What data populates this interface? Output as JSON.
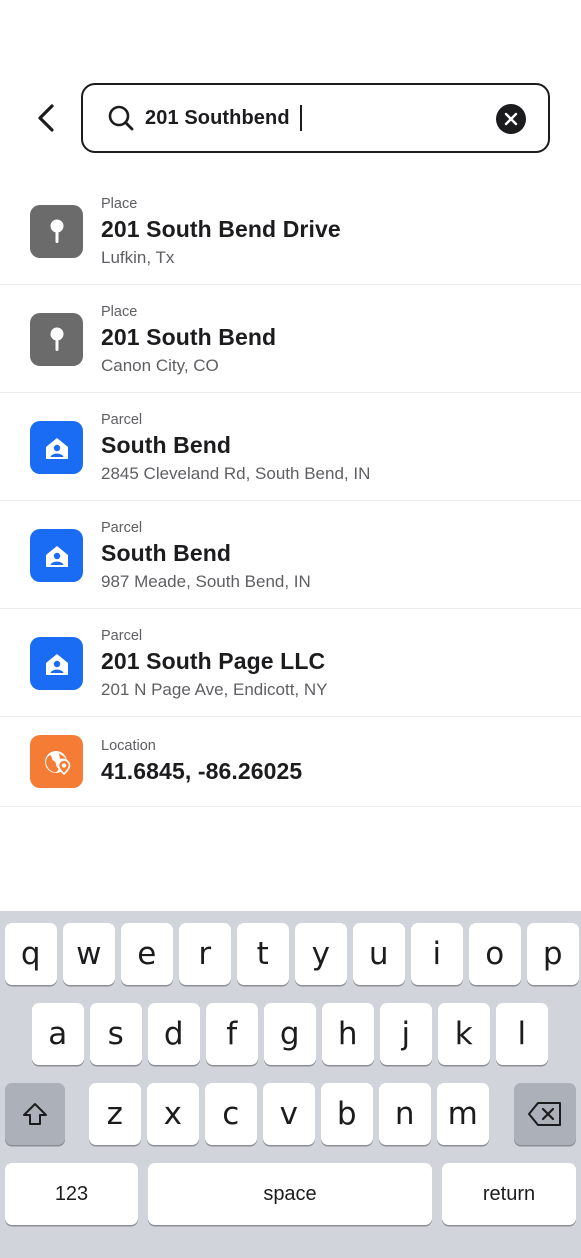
{
  "search": {
    "query": "201 Southbend"
  },
  "results": [
    {
      "type": "Place",
      "title": "201 South Bend Drive",
      "subtitle": "Lufkin, Tx",
      "icon": "pin-icon",
      "color": "#6b6b6b"
    },
    {
      "type": "Place",
      "title": "201 South Bend",
      "subtitle": "Canon City, CO",
      "icon": "pin-icon",
      "color": "#6b6b6b"
    },
    {
      "type": "Parcel",
      "title": "South Bend",
      "subtitle": "2845 Cleveland Rd, South Bend, IN",
      "icon": "parcel-owner-icon",
      "color": "#1a6cf5"
    },
    {
      "type": "Parcel",
      "title": "South Bend",
      "subtitle": "987 Meade, South Bend, IN",
      "icon": "parcel-owner-icon",
      "color": "#1a6cf5"
    },
    {
      "type": "Parcel",
      "title": "201 South Page LLC",
      "subtitle": "201 N Page Ave, Endicott, NY",
      "icon": "parcel-owner-icon",
      "color": "#1a6cf5"
    },
    {
      "type": "Location",
      "title": "41.6845, -86.26025",
      "subtitle": "",
      "icon": "globe-pin-icon",
      "color": "#f47c35"
    }
  ],
  "keyboard": {
    "row1": [
      "q",
      "w",
      "e",
      "r",
      "t",
      "y",
      "u",
      "i",
      "o",
      "p"
    ],
    "row2": [
      "a",
      "s",
      "d",
      "f",
      "g",
      "h",
      "j",
      "k",
      "l"
    ],
    "row3": [
      "z",
      "x",
      "c",
      "v",
      "b",
      "n",
      "m"
    ],
    "numbers_label": "123",
    "space_label": "space",
    "return_label": "return"
  }
}
